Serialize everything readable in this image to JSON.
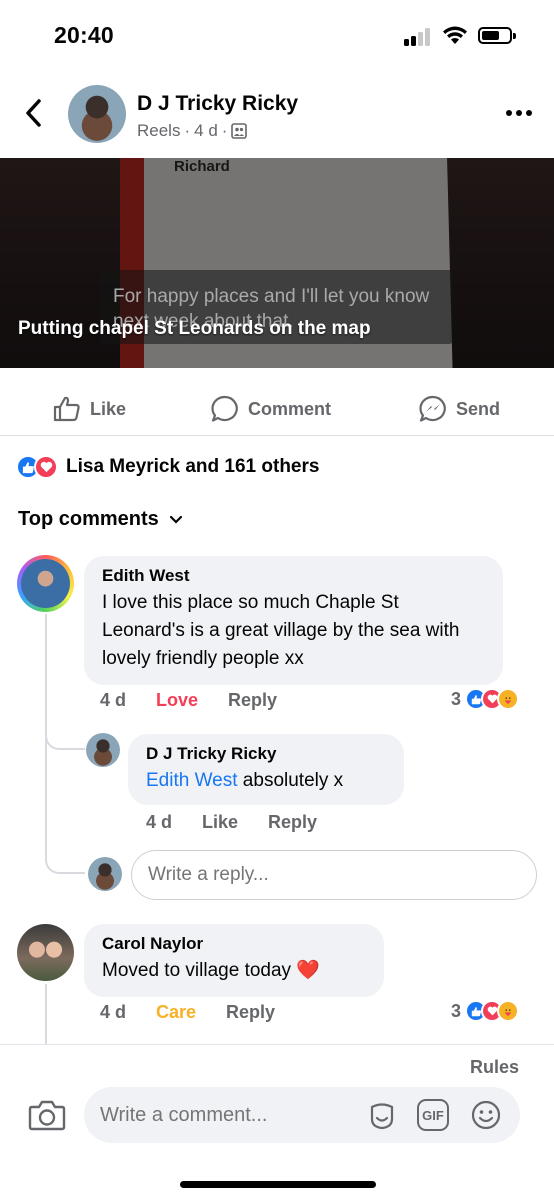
{
  "status_bar": {
    "time": "20:40"
  },
  "header": {
    "name": "D J Tricky Ricky",
    "source": "Reels",
    "age": "4 d",
    "sep": "·"
  },
  "video": {
    "board_label": "Richard",
    "caption": "For happy places and I'll let you know next week about that.",
    "title": "Putting chapel St Leonards on the map"
  },
  "actions": {
    "like": "Like",
    "comment": "Comment",
    "send": "Send"
  },
  "reactions_summary": {
    "text": "Lisa Meyrick and 161 others"
  },
  "top_comments_label": "Top comments",
  "comments": [
    {
      "author": "Edith West",
      "text": "I love this place so much  Chaple St Leonard's is a great village by the sea with lovely friendly people xx",
      "time": "4 d",
      "reaction_label": "Love",
      "reply_label": "Reply",
      "reaction_count": "3"
    },
    {
      "author": "D J Tricky Ricky",
      "mention": "Edith West",
      "text": " absolutely x",
      "time": "4 d",
      "reaction_label": "Like",
      "reply_label": "Reply"
    },
    {
      "author": "Carol Naylor",
      "text": "Moved to village today ❤️",
      "time": "4 d",
      "reaction_label": "Care",
      "reply_label": "Reply",
      "reaction_count": "3"
    }
  ],
  "reply_input": {
    "placeholder": "Write a reply..."
  },
  "composer": {
    "rules": "Rules",
    "placeholder": "Write a comment...",
    "gif": "GIF"
  },
  "colors": {
    "accent": "#1877f2",
    "love": "#f33e58",
    "care": "#f7b125",
    "muted": "#65676b"
  }
}
